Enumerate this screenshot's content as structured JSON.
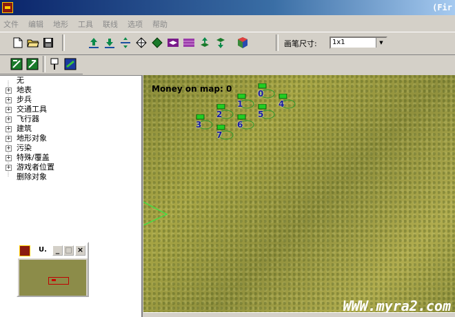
{
  "window": {
    "title": "(Fir"
  },
  "menu": [
    "文件",
    "编辑",
    "地形",
    "工具",
    "联线",
    "选项",
    "帮助"
  ],
  "toolbar": {
    "brush_label": "画笔尺寸:",
    "brush_value": "1x1",
    "tools_row1": [
      "new-file",
      "open-folder",
      "save",
      "raise-ground",
      "lower-ground",
      "flatten",
      "diamond-outline",
      "diamond-fill",
      "purple-tile-1",
      "purple-tile-2",
      "raise-cliff",
      "lower-cliff",
      "cube"
    ],
    "tools_row2": [
      "green-flag-1",
      "green-flag-2",
      "waypoint",
      "blue-tile"
    ]
  },
  "tree": [
    {
      "label": "无",
      "expandable": false
    },
    {
      "label": "地表",
      "expandable": true
    },
    {
      "label": "步兵",
      "expandable": true
    },
    {
      "label": "交通工具",
      "expandable": true
    },
    {
      "label": "飞行器",
      "expandable": true
    },
    {
      "label": "建筑",
      "expandable": true
    },
    {
      "label": "地形对象",
      "expandable": true
    },
    {
      "label": "污染",
      "expandable": true
    },
    {
      "label": "特殊/覆盖",
      "expandable": true
    },
    {
      "label": "游戏者位置",
      "expandable": true
    },
    {
      "label": "删除对象",
      "expandable": false
    }
  ],
  "minimap": {
    "title": "U."
  },
  "map": {
    "money_text": "Money on map: 0",
    "waypoints": [
      "0",
      "1",
      "2",
      "3",
      "4",
      "5",
      "6",
      "7"
    ]
  },
  "watermark": "WWW.myra2.com",
  "colors": {
    "title_start": "#0a246a",
    "grass": "#a8a645",
    "flag": "#22cc22",
    "number": "#1a1aa0"
  }
}
